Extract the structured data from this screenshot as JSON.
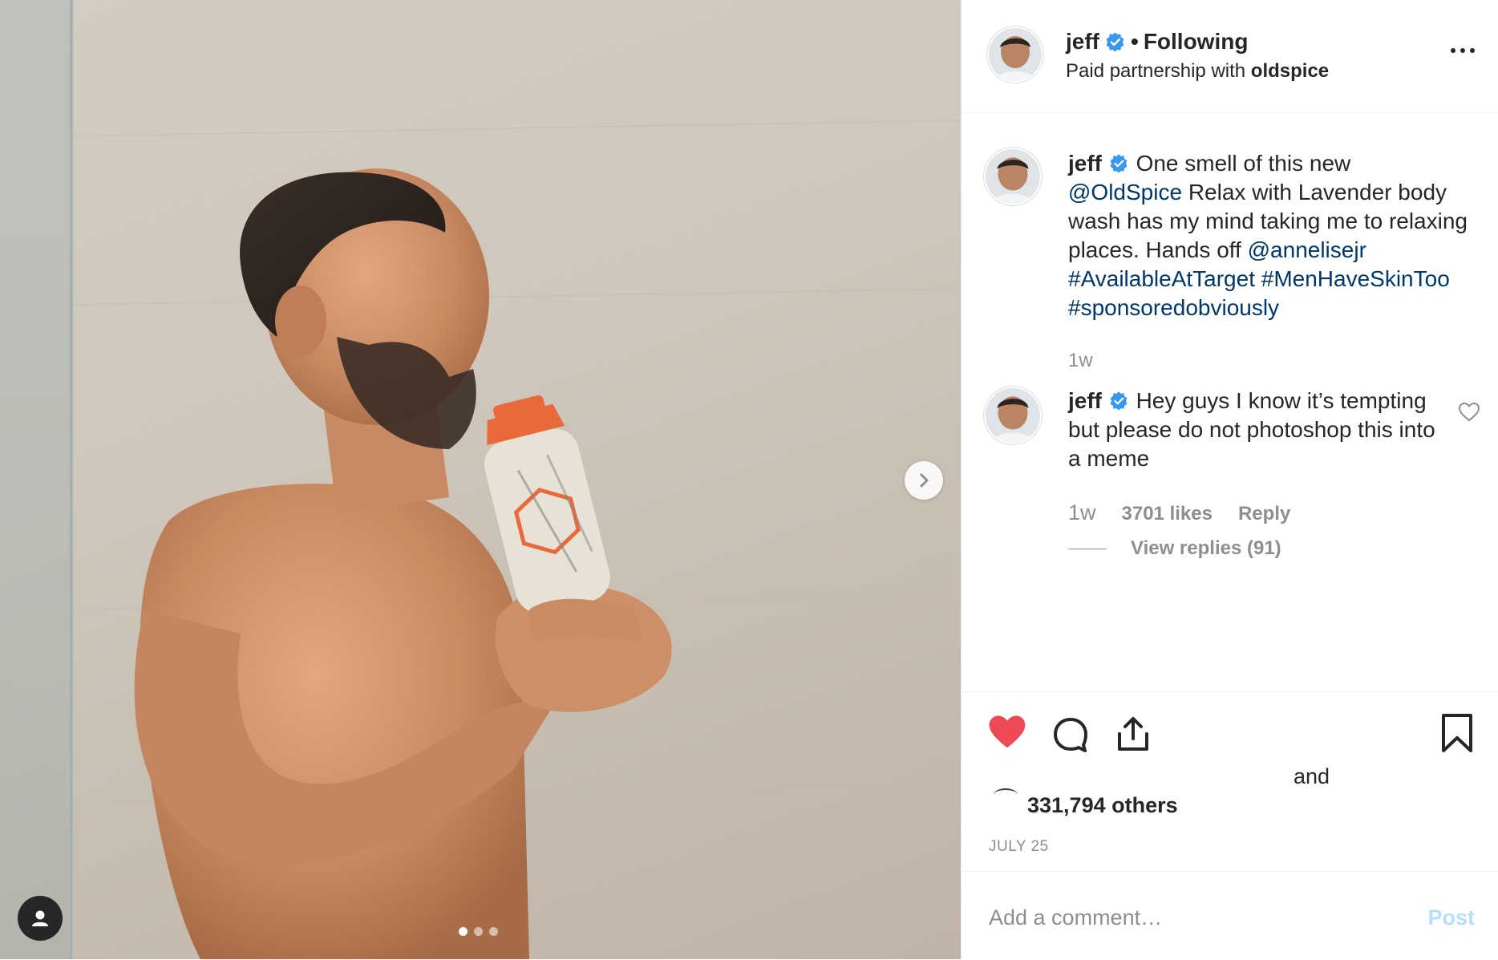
{
  "post": {
    "username": "jeff",
    "separator": "•",
    "following_label": "Following",
    "partnership_prefix": "Paid partnership with",
    "partnership_brand": "oldspice",
    "image_dots": 3,
    "active_dot": 0
  },
  "caption": {
    "username": "jeff",
    "segments": [
      {
        "t": "One smell of this new ",
        "link": false
      },
      {
        "t": "@OldSpice",
        "link": true
      },
      {
        "t": " Relax with Lavender body wash has my mind taking me to relaxing places. Hands off ",
        "link": false
      },
      {
        "t": "@annelisejr",
        "link": true
      },
      {
        "t": " ",
        "link": false
      },
      {
        "t": "#AvailableAtTarget",
        "link": true
      },
      {
        "t": " ",
        "link": false
      },
      {
        "t": "#MenHaveSkinToo",
        "link": true
      },
      {
        "t": " ",
        "link": false
      },
      {
        "t": "#sponsoredobviously",
        "link": true
      }
    ],
    "time": "1w"
  },
  "reply": {
    "username": "jeff",
    "text": "Hey guys I know it’s tempting but please do not photoshop this into a meme",
    "time": "1w",
    "likes": "3701 likes",
    "reply_label": "Reply",
    "view_replies": "View replies (91)"
  },
  "engagement": {
    "liked": true,
    "and_label": "and",
    "others_label": "331,794 others",
    "date": "JULY 25"
  },
  "comment_input": {
    "placeholder": "Add a comment…",
    "post_label": "Post"
  },
  "colors": {
    "link": "#00376b",
    "heart": "#ed4956",
    "verified": "#3897f0",
    "post_disabled": "#b2dffc"
  }
}
